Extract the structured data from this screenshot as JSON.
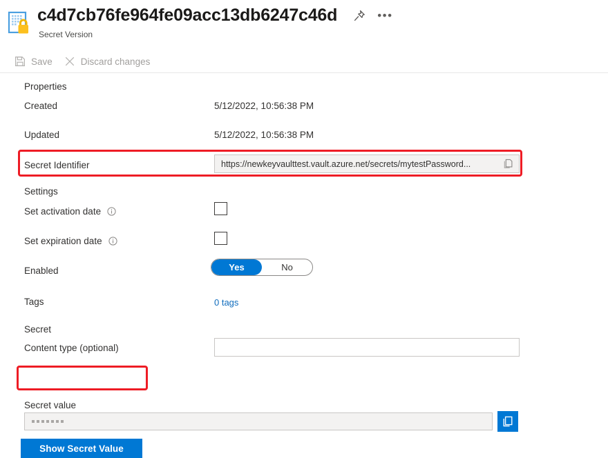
{
  "header": {
    "title": "c4d7cb76fe964fe09acc13db6247c46d",
    "subtitle": "Secret Version",
    "pin_icon": "pin-icon",
    "more_icon": "ellipsis-icon",
    "resource_icon": "secret-certificate-icon"
  },
  "commandbar": {
    "save_label": "Save",
    "save_icon": "save-floppy-icon",
    "discard_label": "Discard changes",
    "discard_icon": "close-x-icon"
  },
  "properties": {
    "section_label": "Properties",
    "created_label": "Created",
    "created_value": "5/12/2022, 10:56:38 PM",
    "updated_label": "Updated",
    "updated_value": "5/12/2022, 10:56:38 PM",
    "secret_identifier_label": "Secret Identifier",
    "secret_identifier_value": "https://newkeyvaulttest.vault.azure.net/secrets/mytestPassword...",
    "copy_icon": "copy-icon"
  },
  "settings": {
    "section_label": "Settings",
    "activation_date_label": "Set activation date",
    "activation_date_checked": false,
    "expiration_date_label": "Set expiration date",
    "expiration_date_checked": false,
    "info_icon": "info-icon",
    "enabled_label": "Enabled",
    "enabled_yes": "Yes",
    "enabled_no": "No",
    "enabled_value": "Yes",
    "tags_label": "Tags",
    "tags_value": "0 tags"
  },
  "secret": {
    "section_label": "Secret",
    "content_type_label": "Content type (optional)",
    "content_type_value": "",
    "show_secret_button": "Show Secret Value",
    "secret_value_label": "Secret value",
    "secret_value_masked": "•••••••",
    "copy_icon": "copy-icon"
  },
  "colors": {
    "accent": "#0078d4",
    "link": "#0f6cbd",
    "highlight": "#ee1c25",
    "disabled_text": "#a19f9d",
    "field_bg": "#f3f2f1"
  }
}
